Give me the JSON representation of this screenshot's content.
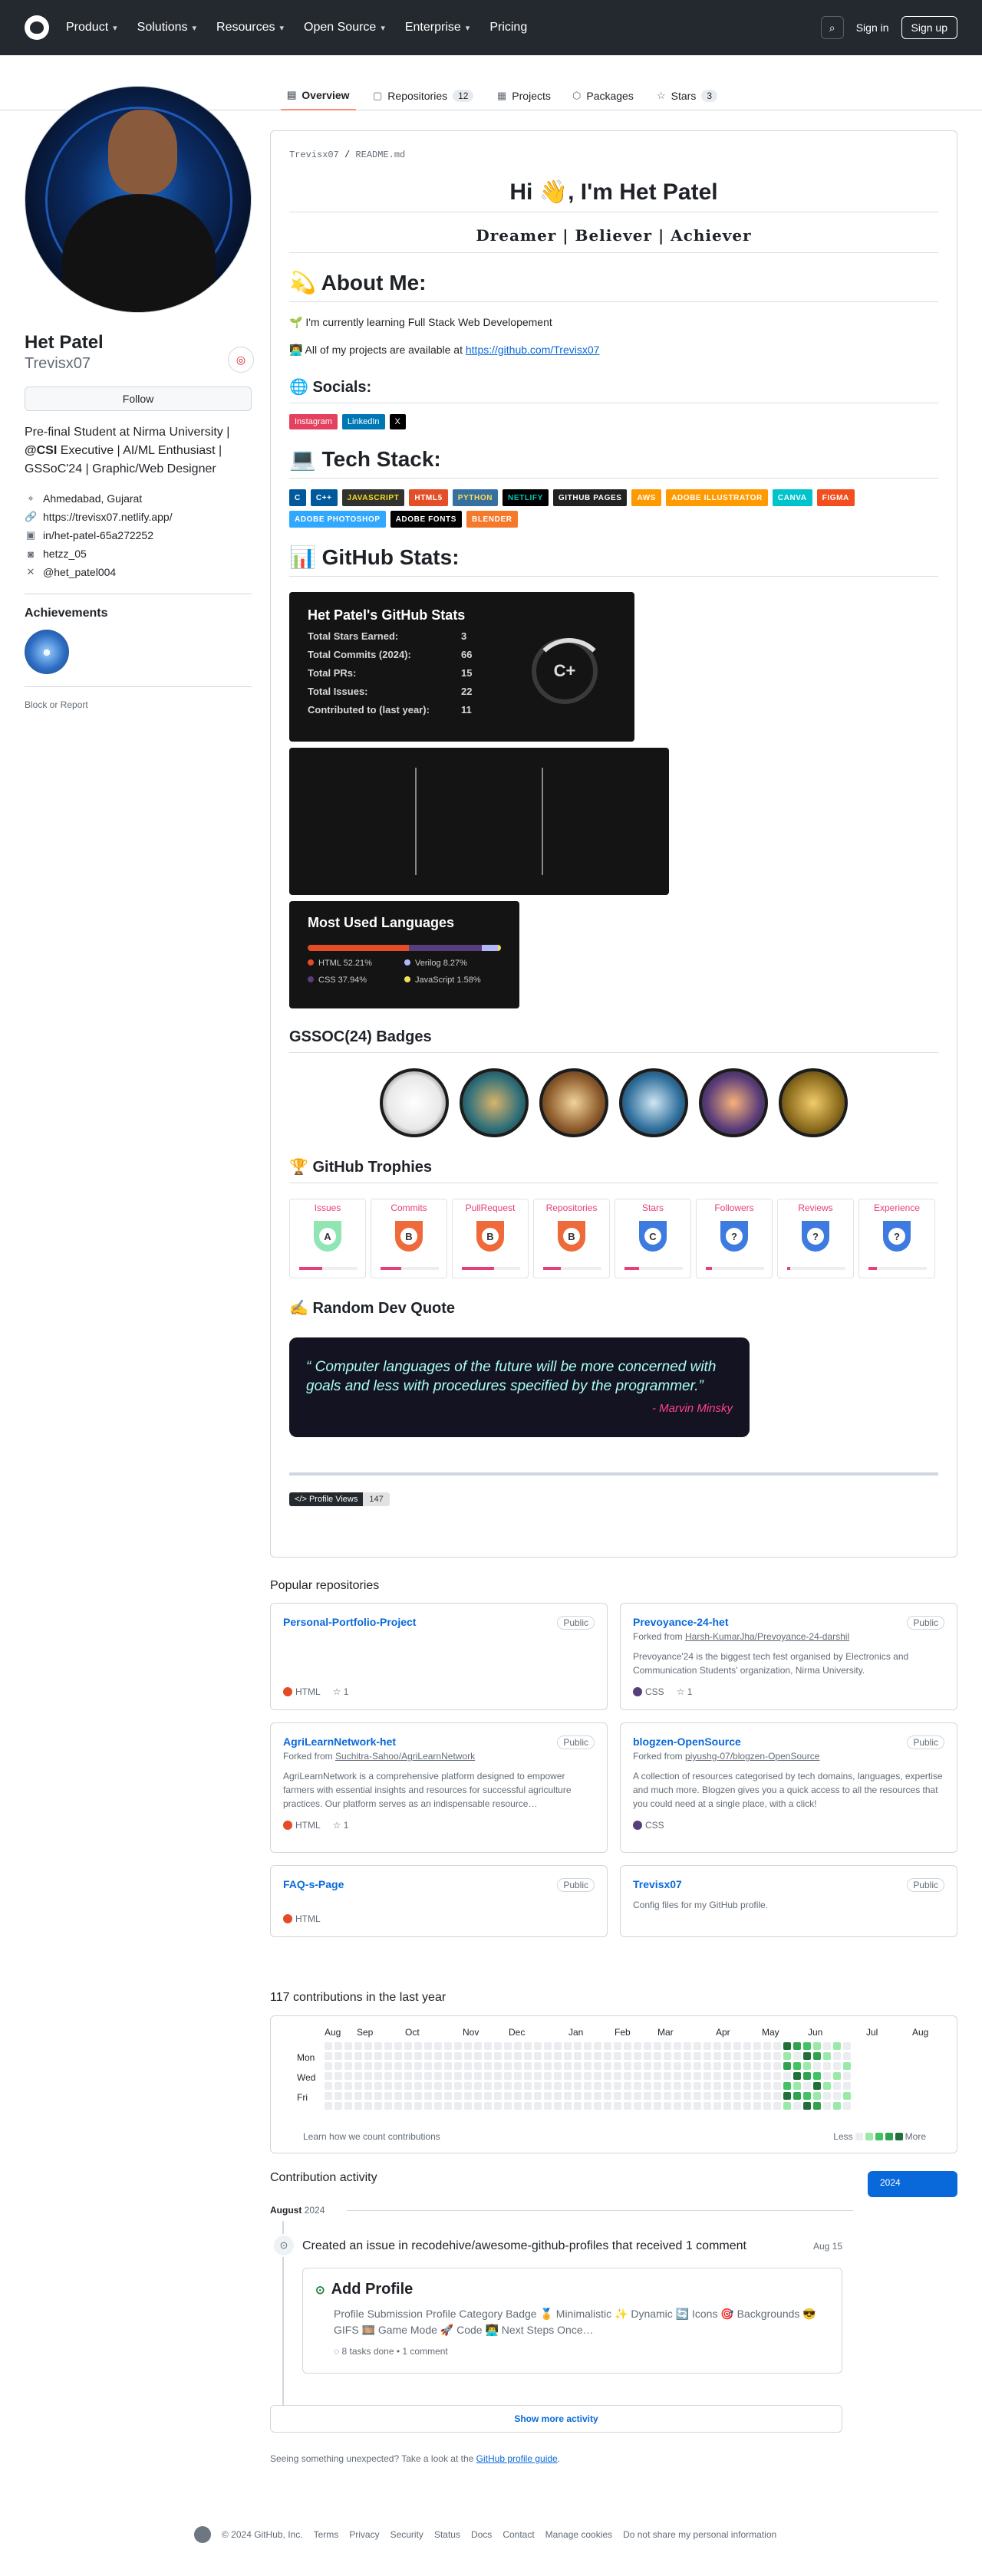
{
  "header": {
    "nav": [
      "Product",
      "Solutions",
      "Resources",
      "Open Source",
      "Enterprise",
      "Pricing"
    ],
    "sign_in": "Sign in",
    "sign_up": "Sign up"
  },
  "tabs": [
    {
      "label": "Overview"
    },
    {
      "label": "Repositories",
      "count": "12"
    },
    {
      "label": "Projects"
    },
    {
      "label": "Packages"
    },
    {
      "label": "Stars",
      "count": "3"
    }
  ],
  "profile": {
    "name": "Het Patel",
    "login": "Trevisx07",
    "follow": "Follow",
    "bio_pre": "Pre-final Student at Nirma University | ",
    "bio_org": "@CSI",
    "bio_post": " Executive | AI/ML Enthusiast | GSSoC'24 | Graphic/Web Designer",
    "location": "Ahmedabad, Gujarat",
    "website": "https://trevisx07.netlify.app/",
    "linkedin": "in/het-patel-65a272252",
    "other": "hetzz_05",
    "x": "@het_patel004",
    "achievements": "Achievements",
    "block": "Block or Report"
  },
  "readme": {
    "path_user": "Trevisx07",
    "path_file": "README.md",
    "title": "Hi 👋, I'm Het Patel",
    "subtitle": "Dreamer | Believer | Achiever",
    "about": "💫 About Me:",
    "learning": "🌱 I'm currently learning Full Stack Web Developement",
    "projects_pre": "👨‍💻 All of my projects are available at ",
    "projects_link": "https://github.com/Trevisx07",
    "socials": "🌐 Socials:",
    "social_badges": [
      "Instagram",
      "LinkedIn",
      "X"
    ],
    "tech": "💻 Tech Stack:",
    "tech_badges": [
      "C",
      "C++",
      "JavaScript",
      "HTML5",
      "Python",
      "Netlify",
      "GitHub Pages",
      "AWS",
      "Adobe Illustrator",
      "Canva",
      "Figma",
      "Adobe Photoshop",
      "Adobe Fonts",
      "Blender"
    ],
    "ghstats": "📊 GitHub Stats:",
    "stats_title": "Het Patel's GitHub Stats",
    "stats": [
      {
        "k": "Total Stars Earned:",
        "v": "3"
      },
      {
        "k": "Total Commits (2024):",
        "v": "66"
      },
      {
        "k": "Total PRs:",
        "v": "15"
      },
      {
        "k": "Total Issues:",
        "v": "22"
      },
      {
        "k": "Contributed to (last year):",
        "v": "11"
      }
    ],
    "rank": "C+",
    "langs_title": "Most Used Languages",
    "langs": [
      {
        "name": "HTML 52.21%",
        "pct": 52.21,
        "color": "#e34c26"
      },
      {
        "name": "Verilog 8.27%",
        "pct": 8.27,
        "color": "#b2b7f8"
      },
      {
        "name": "CSS 37.94%",
        "pct": 37.94,
        "color": "#563d7c"
      },
      {
        "name": "JavaScript 1.58%",
        "pct": 1.58,
        "color": "#f1e05a"
      }
    ],
    "gssoc": "GSSOC(24) Badges",
    "trophies_h": "🏆 GitHub Trophies",
    "trophies": [
      {
        "t": "Issues",
        "r": "A"
      },
      {
        "t": "Commits",
        "r": "B"
      },
      {
        "t": "PullRequest",
        "r": "B"
      },
      {
        "t": "Repositories",
        "r": "B"
      },
      {
        "t": "Stars",
        "r": "C"
      },
      {
        "t": "Followers",
        "r": "?"
      },
      {
        "t": "Reviews",
        "r": "?"
      },
      {
        "t": "Experience",
        "r": "?"
      }
    ],
    "quote_h": "✍️ Random Dev Quote",
    "quote": "“ Computer languages of the future will be more concerned with goals and less with procedures specified by the programmer.”",
    "quote_author": "- Marvin Minsky",
    "views_label": "</> Profile Views",
    "views": "147"
  },
  "popular": "Popular repositories",
  "repos": [
    {
      "name": "Personal-Portfolio-Project",
      "vis": "Public",
      "fork": "",
      "desc": "",
      "lang": "HTML",
      "color": "#e34c26",
      "stars": "1"
    },
    {
      "name": "Prevoyance-24-het",
      "vis": "Public",
      "fork": "Harsh-KumarJha/Prevoyance-24-darshil",
      "desc": "Prevoyance'24 is the biggest tech fest organised by Electronics and Communication Students' organization, Nirma University.",
      "lang": "CSS",
      "color": "#563d7c",
      "stars": "1"
    },
    {
      "name": "AgriLearnNetwork-het",
      "vis": "Public",
      "fork": "Suchitra-Sahoo/AgriLearnNetwork",
      "desc": "AgriLearnNetwork is a comprehensive platform designed to empower farmers with essential insights and resources for successful agriculture practices. Our platform serves as an indispensable resource…",
      "lang": "HTML",
      "color": "#e34c26",
      "stars": "1"
    },
    {
      "name": "blogzen-OpenSource",
      "vis": "Public",
      "fork": "piyushg-07/blogzen-OpenSource",
      "desc": "A collection of resources categorised by tech domains, languages, expertise and much more. Blogzen gives you a quick access to all the resources that you could need at a single place, with a click!",
      "lang": "CSS",
      "color": "#563d7c",
      "stars": ""
    },
    {
      "name": "FAQ-s-Page",
      "vis": "Public",
      "fork": "",
      "desc": "",
      "lang": "HTML",
      "color": "#e34c26",
      "stars": ""
    },
    {
      "name": "Trevisx07",
      "vis": "Public",
      "fork": "",
      "desc": "Config files for my GitHub profile.",
      "lang": "",
      "color": "",
      "stars": ""
    }
  ],
  "contrib": {
    "title": "117 contributions in the last year",
    "months": [
      "Aug",
      "Sep",
      "Oct",
      "Nov",
      "Dec",
      "Jan",
      "Feb",
      "Mar",
      "Apr",
      "May",
      "Jun",
      "Jul",
      "Aug"
    ],
    "days": [
      "Mon",
      "Wed",
      "Fri"
    ],
    "learn": "Learn how we count contributions",
    "less": "Less",
    "more": "More"
  },
  "activity": {
    "title": "Contribution activity",
    "year": "2024",
    "month": "August",
    "month_year": "2024",
    "event": "Created an issue in recodehive/awesome-github-profiles that received 1 comment",
    "date": "Aug 15",
    "issue_title": "Add Profile",
    "issue_body": "Profile Submission Profile Category Badge 🏅 Minimalistic ✨ Dynamic 🔄 Icons 🎯 Backgrounds 😎 GIFS 🎞️ Game Mode 🚀 Code 👨‍💻 Next Steps Once…",
    "tasks": "8 tasks done",
    "comments": "1 comment",
    "show_more": "Show more activity",
    "unexpected": "Seeing something unexpected? Take a look at the ",
    "guide": "GitHub profile guide",
    "period": "."
  },
  "footer": [
    "© 2024 GitHub, Inc.",
    "Terms",
    "Privacy",
    "Security",
    "Status",
    "Docs",
    "Contact",
    "Manage cookies",
    "Do not share my personal information"
  ]
}
